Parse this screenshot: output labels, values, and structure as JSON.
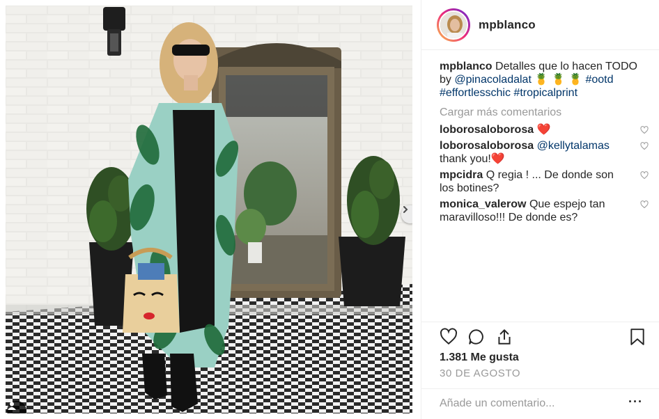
{
  "post": {
    "username": "mpblanco",
    "caption": {
      "username": "mpblanco",
      "text_before": "Detalles que lo hacen TODO by ",
      "mention": "@pinacoladalat",
      "emoji": "🍍 🍍 🍍",
      "hashtags": "#ootd #effortlesschic #tropicalprint"
    },
    "load_more_label": "Cargar más comentarios",
    "comments": [
      {
        "username": "loborosaloborosa",
        "text": "",
        "emoji": "❤️"
      },
      {
        "username": "loborosaloborosa",
        "mention": "@kellytalamas",
        "text": " thank you!",
        "emoji": "❤️"
      },
      {
        "username": "mpcidra",
        "text": "Q regia ! ... De donde son los botines?"
      },
      {
        "username": "monica_valerow",
        "text": "Que espejo tan maravilloso!!! De donde es?"
      }
    ],
    "likes_label": "1.381 Me gusta",
    "date_label": "30 DE AGOSTO",
    "add_comment_placeholder": "Añade un comentario...",
    "more_options_label": "···"
  },
  "icons": [
    "heart-icon",
    "comment-icon",
    "share-icon",
    "bookmark-icon",
    "chevron-right-icon",
    "user-tag-icon"
  ],
  "colors": {
    "link": "#003569",
    "muted": "#999999",
    "border": "#efefef",
    "heart": "#ed4956"
  }
}
